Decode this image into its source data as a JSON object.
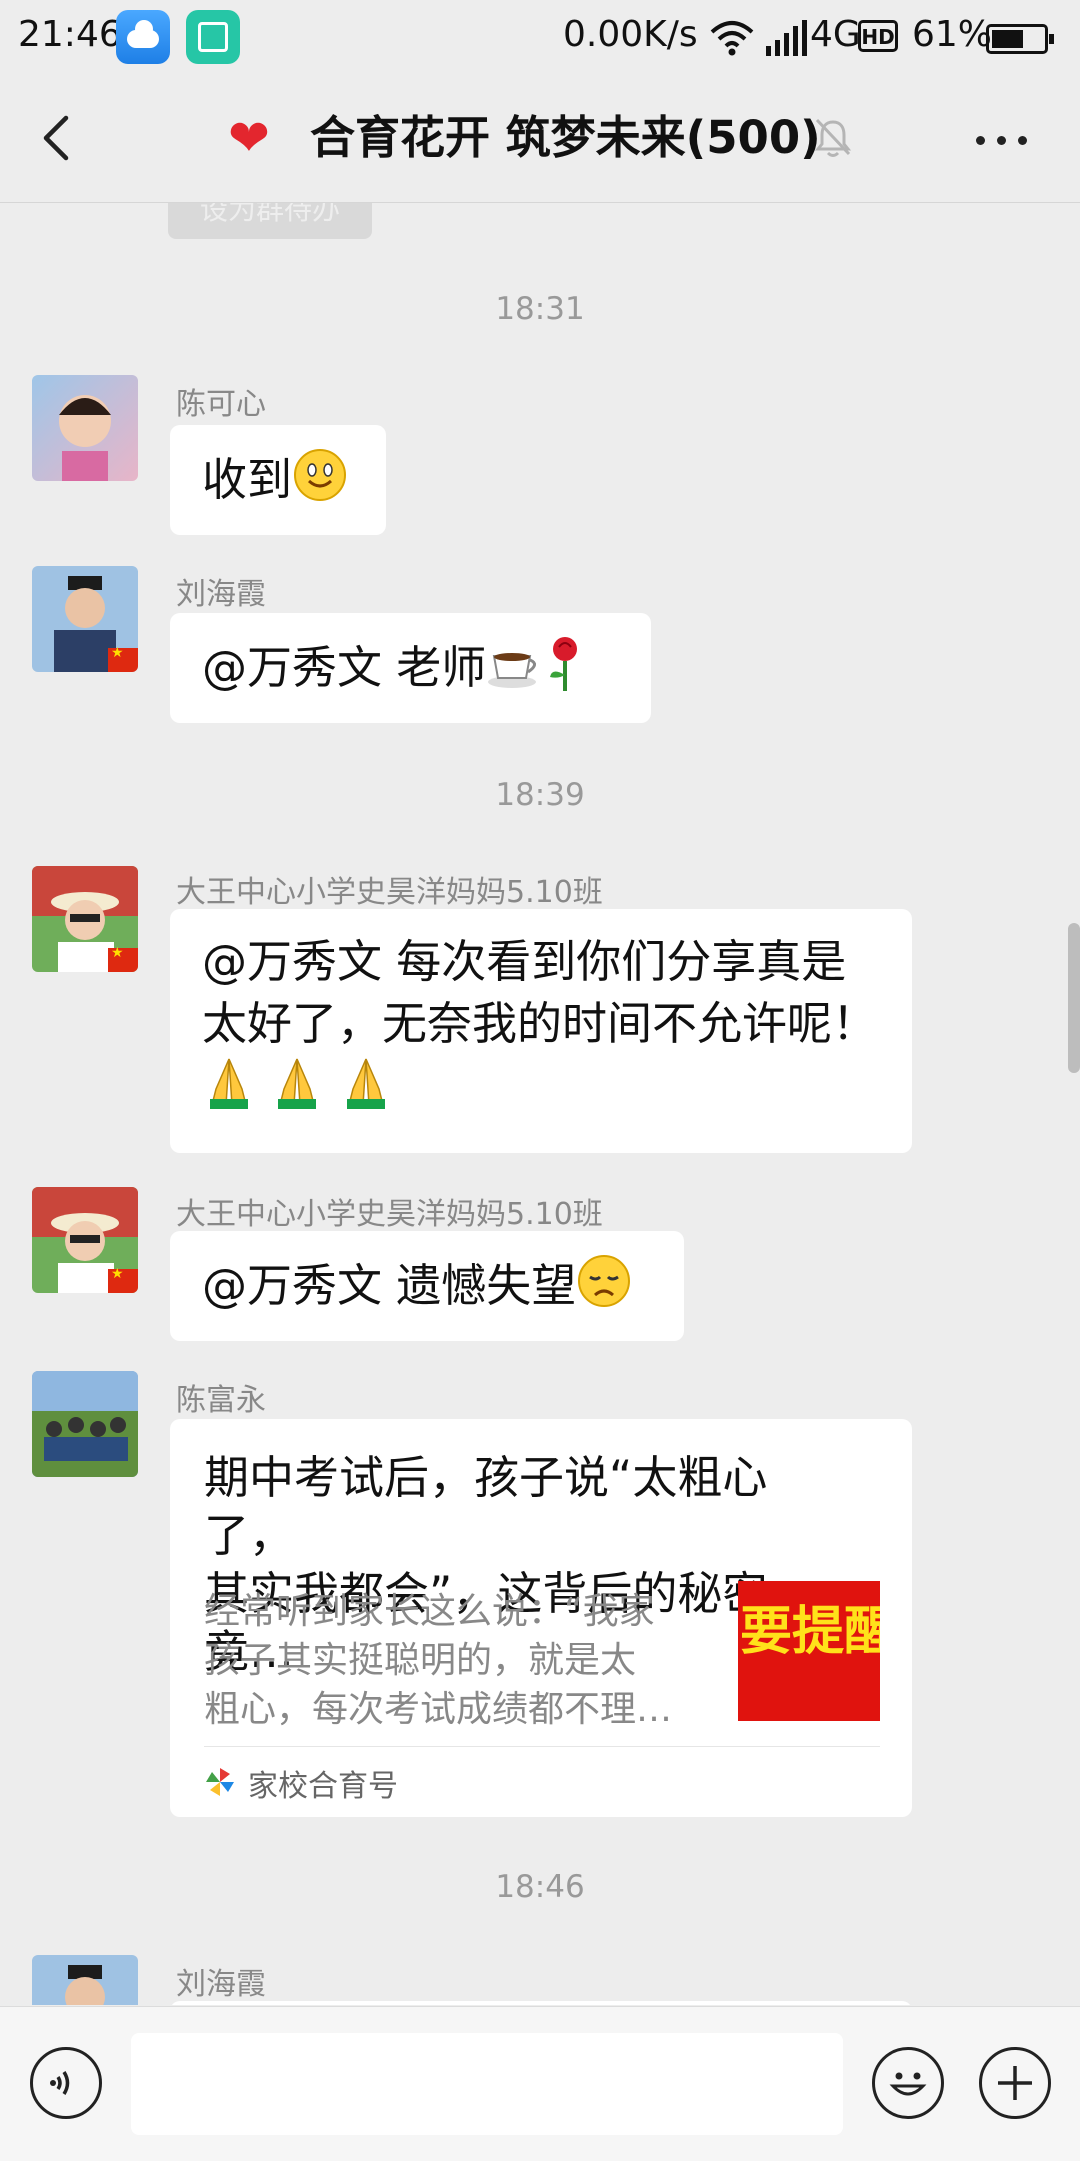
{
  "status_bar": {
    "time": "21:46",
    "net_speed": "0.00K/s",
    "network_type": "4G",
    "hd_label": "HD",
    "battery_percent": "61%",
    "battery_level": 0.61
  },
  "header": {
    "title": "合育花开 筑梦未来(500)"
  },
  "pinned_remnant": "设为群待办",
  "messages": {
    "ts1": "18:31",
    "m1": {
      "sender": "陈可心",
      "text": "收到"
    },
    "m2": {
      "sender": "刘海霞",
      "text": "@万秀文  老师"
    },
    "ts2": "18:39",
    "m3": {
      "sender": "大王中心小学史昊洋妈妈5.10班",
      "line1": "@万秀文  每次看到你们分享真是",
      "line2": "太好了，无奈我的时间不允许呢！"
    },
    "m4": {
      "sender": "大王中心小学史昊洋妈妈5.10班",
      "text": "@万秀文  遗憾失望"
    },
    "m5": {
      "sender": "陈富永",
      "title_line1": "期中考试后，孩子说“太粗心了，",
      "title_line2": "其实我都会”，这背后的秘密竟…",
      "desc_line1": "经常听到家长这么说：“我家",
      "desc_line2": "孩子其实挺聪明的，就是太",
      "desc_line3": "粗心，每次考试成绩都不理…",
      "thumb_text": "要提醒",
      "source": "家校合育号"
    },
    "ts3": "18:46",
    "m6": {
      "sender": "刘海霞"
    }
  },
  "icons": [
    "weather-icon",
    "scan-icon",
    "wifi-icon",
    "signal-icon",
    "battery-icon",
    "back-icon",
    "heart-icon",
    "mute-icon",
    "more-icon",
    "smile-emoji",
    "coffee-emoji",
    "rose-emoji",
    "pray-emoji",
    "sad-emoji",
    "voice-icon",
    "emoji-icon",
    "plus-icon"
  ],
  "colors": {
    "accent_red": "#e3262e",
    "background": "#ededed",
    "bubble": "#ffffff"
  }
}
